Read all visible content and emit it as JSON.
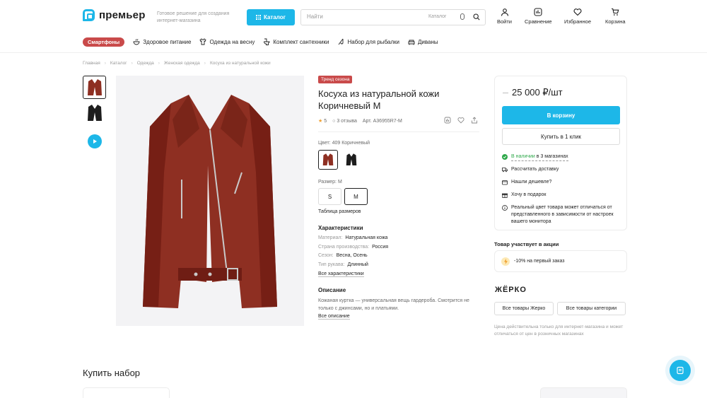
{
  "header": {
    "logo_text": "премьер",
    "tagline": "Готовое решение для создания интернет-магазина",
    "catalog_label": "Каталог",
    "search_placeholder": "Найти",
    "search_category": "Каталог",
    "actions": [
      {
        "label": "Войти",
        "icon": "user-icon"
      },
      {
        "label": "Сравнение",
        "icon": "compare-icon"
      },
      {
        "label": "Избранное",
        "icon": "heart-icon"
      },
      {
        "label": "Корзина",
        "icon": "cart-icon"
      }
    ]
  },
  "nav": {
    "promo": "Смартфоны",
    "items": [
      {
        "label": "Здоровое питание",
        "icon": "food-icon"
      },
      {
        "label": "Одежда на весну",
        "icon": "shirt-icon"
      },
      {
        "label": "Комплект сантехники",
        "icon": "toilet-icon"
      },
      {
        "label": "Набор для рыбалки",
        "icon": "fishing-icon"
      },
      {
        "label": "Диваны",
        "icon": "sofa-icon"
      }
    ]
  },
  "breadcrumbs": [
    "Главная",
    "Каталог",
    "Одежда",
    "Женская одежда",
    "Косуха из натуральной кожи"
  ],
  "product": {
    "badge": "Тренд сезона",
    "title": "Косуха из натуральной кожи Коричневый M",
    "rating": "5",
    "reviews": "3 отзыва",
    "article": "Арт. A36955R7-M",
    "color_label": "Цвет: 409 Коричневый",
    "size_label": "Размер: M",
    "sizes": [
      "S",
      "M"
    ],
    "size_selected": "M",
    "size_table_link": "Таблица размеров",
    "characteristics_title": "Характеристики",
    "characteristics": [
      {
        "k": "Материал:",
        "v": "Натуральная кожа"
      },
      {
        "k": "Страна производства:",
        "v": "Россия"
      },
      {
        "k": "Сезон:",
        "v": "Весна, Осень"
      },
      {
        "k": "Тип рукава:",
        "v": "Длинный"
      }
    ],
    "all_characteristics": "Все характеристики",
    "description_title": "Описание",
    "description": "Кожаная куртка — универсальная вещь гардероба. Смотрится не только с джинсами, но и платьями.",
    "all_description": "Все описание",
    "colors": {
      "brown": "#8e2f22",
      "black": "#1d1d1d"
    }
  },
  "buy": {
    "price": "25 000 ₽/шт",
    "cart_button": "В корзину",
    "one_click": "Купить в 1 клик",
    "availability_prefix": "В наличии",
    "availability_suffix": "в 3 магазинах",
    "delivery": "Рассчитать доставку",
    "cheaper": "Нашли дешевле?",
    "gift": "Хочу в подарок",
    "note": "Реальный цвет товара может отличаться от представленного в зависимости от настроек вашего монитора"
  },
  "promo": {
    "title": "Товар участвует в акции",
    "text": "-10% на первый заказ"
  },
  "brand": {
    "name": "ЖЁРКО",
    "all_brand": "Все товары Жерко",
    "all_category": "Все товары категории",
    "disclaimer": "Цена действительна только для интернет-магазина и может отличаться от цен в розничных магазинах"
  },
  "set": {
    "title": "Купить набор"
  },
  "colors": {
    "accent": "#1db7e8",
    "promo": "#c94a4a",
    "available": "#2ea84a"
  }
}
